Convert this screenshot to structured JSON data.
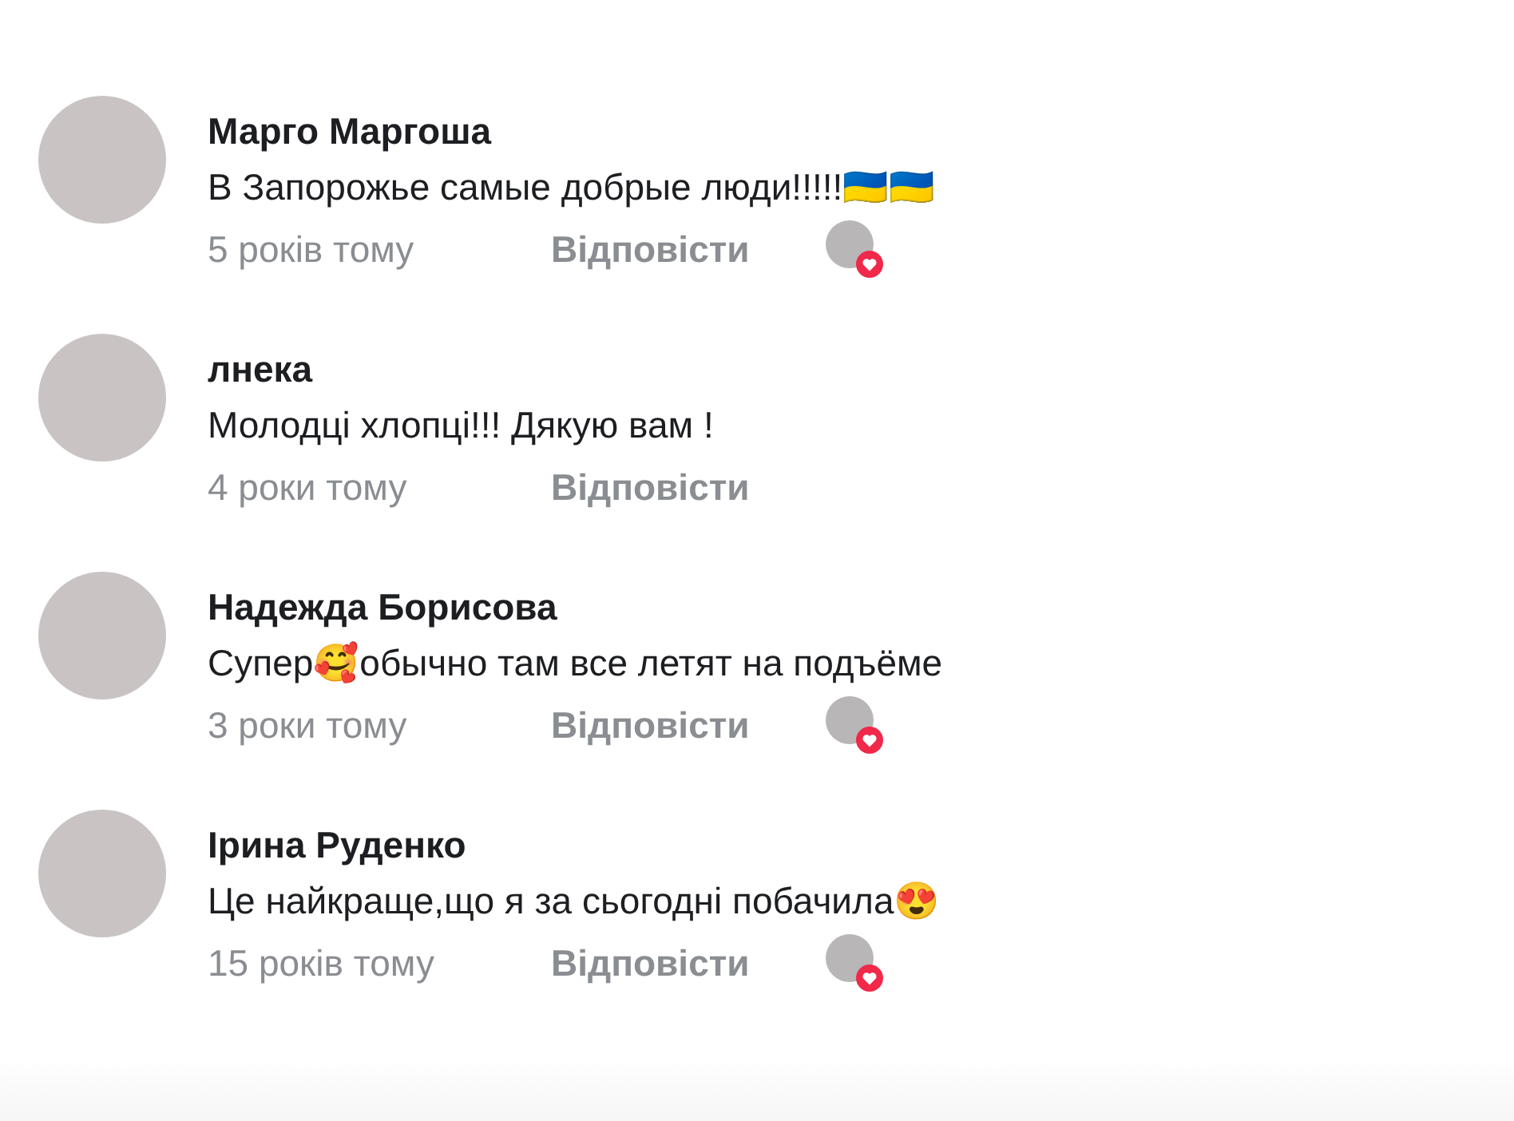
{
  "comments": [
    {
      "author": "Марго Маргоша",
      "text": "В Запорожье самые добрые люди!!!!!🇺🇦🇺🇦",
      "time": "5 років тому",
      "reply": "Відповісти",
      "liked_by_author": true
    },
    {
      "author": "лнека",
      "text": "Молодці хлопці!!! Дякую вам !",
      "time": "4 роки тому",
      "reply": "Відповісти",
      "liked_by_author": false
    },
    {
      "author": "Надежда Борисова",
      "text": "Супер🥰обычно там все летят на подъёме",
      "time": "3 роки тому",
      "reply": "Відповісти",
      "liked_by_author": true
    },
    {
      "author": "Ірина Руденко",
      "text": "Це найкраще,що я за сьогодні побачила😍",
      "time": "15 років тому",
      "reply": "Відповісти",
      "liked_by_author": true
    }
  ]
}
